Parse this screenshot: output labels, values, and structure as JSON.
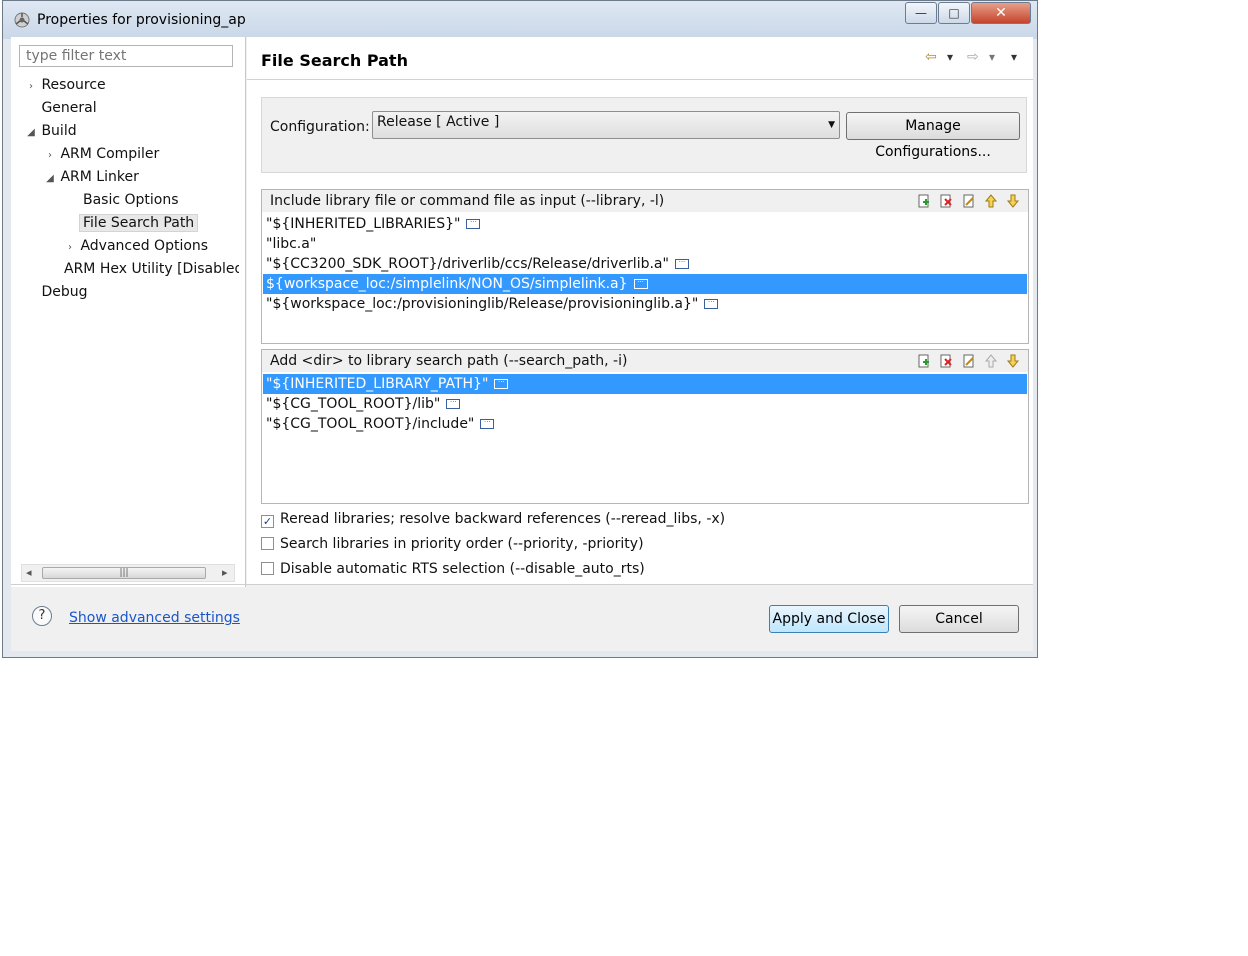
{
  "window": {
    "title": "Properties for provisioning_ap",
    "controls": {
      "minimize": "—",
      "maximize": "□",
      "close": "✕"
    }
  },
  "sidebar": {
    "filter_placeholder": "type filter text",
    "items": [
      {
        "label": "Resource",
        "arrow": "›"
      },
      {
        "label": "General",
        "arrow": ""
      },
      {
        "label": "Build",
        "arrow": "◢"
      },
      {
        "label": "ARM Compiler",
        "arrow": "›"
      },
      {
        "label": "ARM Linker",
        "arrow": "◢"
      },
      {
        "label": "Basic Options",
        "arrow": ""
      },
      {
        "label": "File Search Path",
        "arrow": ""
      },
      {
        "label": "Advanced Options",
        "arrow": "›"
      },
      {
        "label": "ARM Hex Utility  [Disabled]",
        "arrow": ""
      },
      {
        "label": "Debug",
        "arrow": ""
      }
    ],
    "scroll": {
      "left": "◂",
      "right": "▸",
      "grip": "|||"
    }
  },
  "main": {
    "title": "File Search Path",
    "nav": {
      "back": "⇦",
      "forward": "⇨",
      "menu": "▾"
    },
    "configuration": {
      "label": "Configuration:",
      "value": "Release  [ Active ]",
      "manage_label": "Manage Configurations..."
    },
    "libraries": {
      "title": "Include library file or command file as input (--library, -l)",
      "rows": [
        "\"${INHERITED_LIBRARIES}\"",
        "\"libc.a\"",
        "\"${CC3200_SDK_ROOT}/driverlib/ccs/Release/driverlib.a\"",
        "${workspace_loc:/simplelink/NON_OS/simplelink.a}",
        "\"${workspace_loc:/provisioninglib/Release/provisioninglib.a}\""
      ],
      "selected_index": 3
    },
    "search_paths": {
      "title": "Add <dir> to library search path (--search_path, -i)",
      "rows": [
        "\"${INHERITED_LIBRARY_PATH}\"",
        "\"${CG_TOOL_ROOT}/lib\"",
        "\"${CG_TOOL_ROOT}/include\""
      ],
      "selected_index": 0
    },
    "options": [
      {
        "label": "Reread libraries; resolve backward references (--reread_libs, -x)",
        "checked": true
      },
      {
        "label": "Search libraries in priority order (--priority, -priority)",
        "checked": false
      },
      {
        "label": "Disable automatic RTS selection (--disable_auto_rts)",
        "checked": false
      }
    ]
  },
  "footer": {
    "help": "?",
    "advanced_link": "Show advanced settings",
    "apply_label": "Apply and Close",
    "cancel_label": "Cancel"
  },
  "colors": {
    "selection": "#3399ff",
    "link": "#1a56c8",
    "dialog_bg": "#f0f0f0"
  }
}
